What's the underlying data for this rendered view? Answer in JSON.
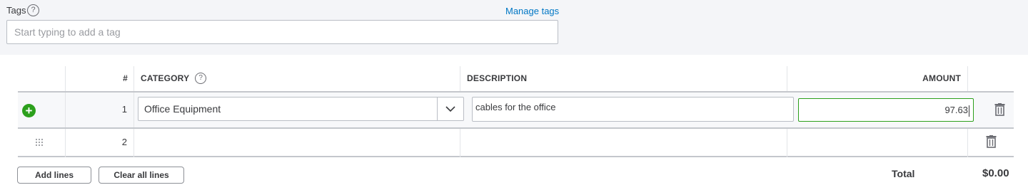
{
  "tags": {
    "label": "Tags",
    "help_icon_glyph": "?",
    "manage_link": "Manage tags",
    "placeholder": "Start typing to add a tag"
  },
  "table": {
    "headers": {
      "number": "#",
      "category": "CATEGORY",
      "description": "DESCRIPTION",
      "amount": "AMOUNT"
    },
    "rows": [
      {
        "number": "1",
        "category": "Office Equipment",
        "description": "cables for the office",
        "amount": "97.63"
      },
      {
        "number": "2",
        "category": "",
        "description": "",
        "amount": ""
      }
    ]
  },
  "actions": {
    "add_lines": "Add lines",
    "clear_all_lines": "Clear all lines"
  },
  "total": {
    "label": "Total",
    "value": "$0.00"
  },
  "colors": {
    "accent_green": "#2ca01c",
    "link_blue": "#0077c5"
  },
  "icons": [
    "help-icon",
    "add-row-icon",
    "chevron-down-icon",
    "trash-icon",
    "drag-handle-icon"
  ]
}
